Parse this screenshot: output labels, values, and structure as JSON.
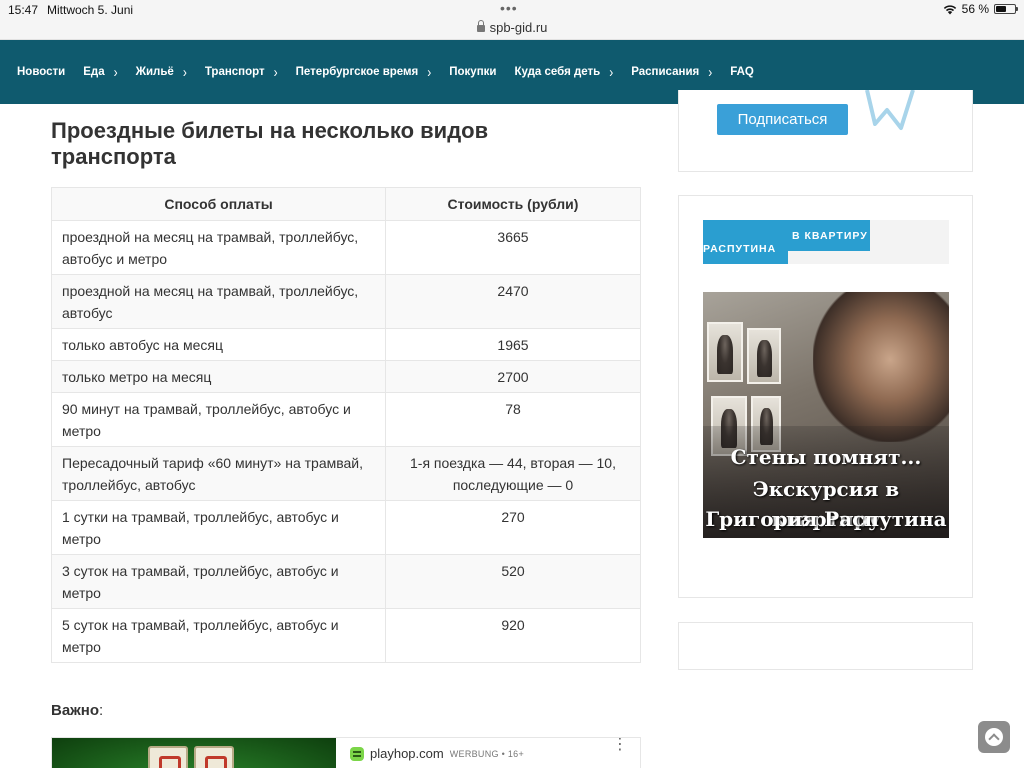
{
  "status_bar": {
    "time": "15:47",
    "date": "Mittwoch 5. Juni",
    "url": "spb-gid.ru",
    "battery": "56 %",
    "battery_level": 0.56
  },
  "nav": {
    "items": [
      {
        "label": "Новости",
        "has_submenu": false
      },
      {
        "label": "Еда",
        "has_submenu": true
      },
      {
        "label": "Жильё",
        "has_submenu": true
      },
      {
        "label": "Транспорт",
        "has_submenu": true
      },
      {
        "label": "Петербургское время",
        "has_submenu": true
      },
      {
        "label": "Покупки",
        "has_submenu": false
      },
      {
        "label": "Куда себя деть",
        "has_submenu": true
      },
      {
        "label": "Расписания",
        "has_submenu": true
      },
      {
        "label": "FAQ",
        "has_submenu": false
      }
    ],
    "background": "#0f5a6e"
  },
  "main": {
    "title": "Проездные билеты на несколько видов транспорта",
    "table": {
      "headers": [
        "Способ оплаты",
        "Стоимость (рубли)"
      ],
      "rows": [
        [
          "проездной на месяц на трамвай, троллейбус, автобус и метро",
          "3665"
        ],
        [
          "проездной на месяц на трамвай, троллейбус, автобус",
          "2470"
        ],
        [
          "только автобус на месяц",
          "1965"
        ],
        [
          "только метро на месяц",
          "2700"
        ],
        [
          "90 минут на трамвай, троллейбус, автобус и метро",
          "78"
        ],
        [
          "Пересадочный тариф «60 минут» на трамвай, троллейбус, автобус",
          "1-я поездка — 44, вторая — 10, последующие — 0"
        ],
        [
          "1 сутки на трамвай, троллейбус, автобус и метро",
          "270"
        ],
        [
          "3 суток на трамвай, троллейбус, автобус и метро",
          "520"
        ],
        [
          "5 суток на трамвай, троллейбус, автобус и метро",
          "920"
        ]
      ]
    },
    "important_label": "Важно",
    "important_suffix": ":"
  },
  "ad": {
    "domain": "playhop.com",
    "label": "WERBUNG • 16+",
    "more": "⋮"
  },
  "sidebar": {
    "subscribe_label": "Подписаться",
    "tab_line1": "В КВАРТИРУ",
    "tab_line2": "РАСПУТИНА",
    "promo_lines": [
      "Стены помнят...",
      "Экскурсия в квартиру",
      "Григория Распутина"
    ],
    "accent": "#2a9ed0"
  }
}
